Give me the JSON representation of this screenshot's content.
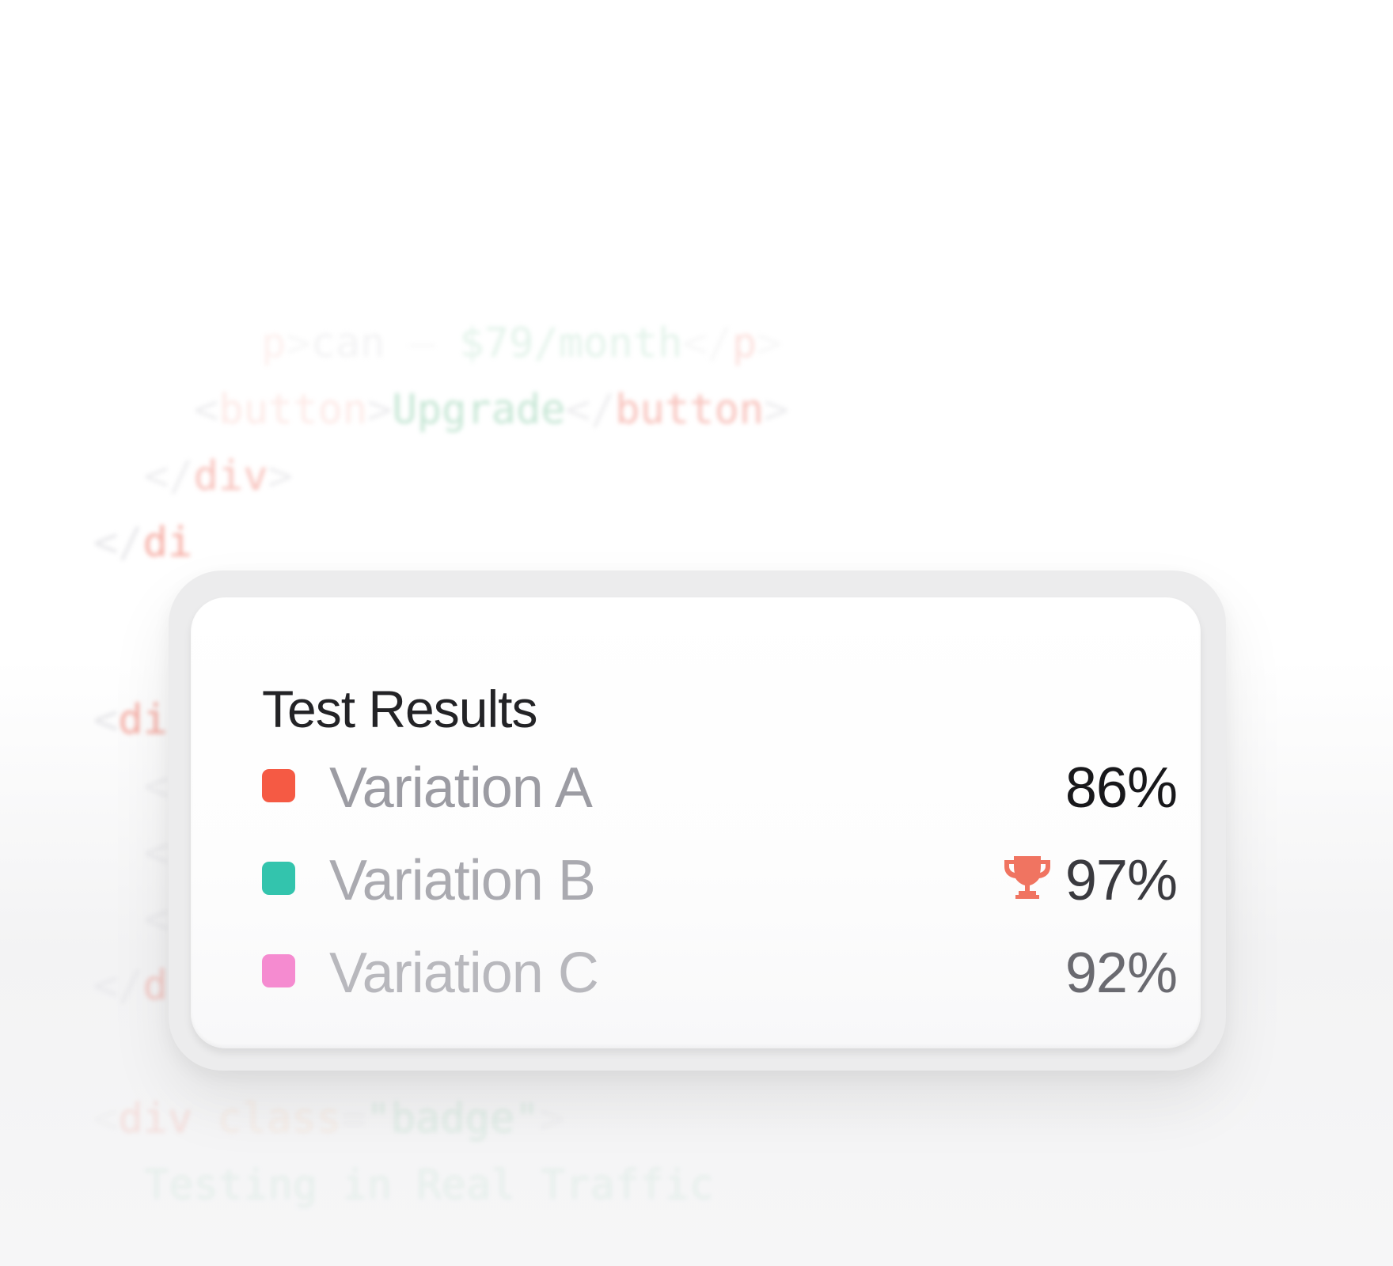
{
  "code_background": {
    "line1": {
      "tag": "p",
      "text_fragment": "can",
      "separator": "—",
      "price": "$79/month"
    },
    "line2": {
      "tag": "button",
      "text": "Upgrade"
    },
    "line3": {
      "tag": "div"
    },
    "line4": {
      "tag": "di"
    },
    "line5": {
      "tag": "di"
    },
    "line9": {
      "tag": "d"
    },
    "line10": {
      "tag": "div",
      "attr": "class",
      "value": "\"badge\""
    },
    "line11": {
      "text": "Testing in Real Traffic"
    }
  },
  "card": {
    "title": "Test Results",
    "rows": [
      {
        "label": "Variation A",
        "value": "86%",
        "color": "#f55a44",
        "label_color": "#9c9ca3",
        "value_color": "#18181b",
        "winner": false
      },
      {
        "label": "Variation B",
        "value": "97%",
        "color": "#33c4ad",
        "label_color": "#aaaab0",
        "value_color": "#3a3a3f",
        "winner": true,
        "icon": "trophy-icon",
        "icon_color": "#f07461"
      },
      {
        "label": "Variation C",
        "value": "92%",
        "color": "#f58bd0",
        "label_color": "#b8b8bd",
        "value_color": "#6a6a70",
        "winner": false
      }
    ]
  }
}
